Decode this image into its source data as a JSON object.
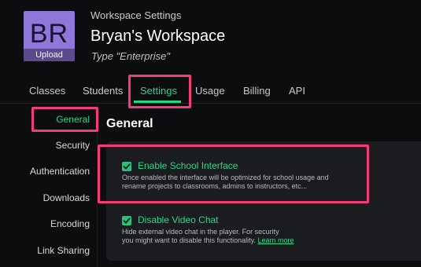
{
  "workspace": {
    "avatar_initials": "BR",
    "avatar_upload_label": "Upload",
    "kicker": "Workspace Settings",
    "name": "Bryan's Workspace",
    "type_text": "Type \"Enterprise\""
  },
  "tabs": [
    {
      "label": "Classes"
    },
    {
      "label": "Students"
    },
    {
      "label": "Settings",
      "active": true
    },
    {
      "label": "Usage"
    },
    {
      "label": "Billing"
    },
    {
      "label": "API"
    }
  ],
  "sidebar": {
    "items": [
      {
        "label": "General",
        "active": true
      },
      {
        "label": "Security"
      },
      {
        "label": "Authentication"
      },
      {
        "label": "Downloads"
      },
      {
        "label": "Encoding"
      },
      {
        "label": "Link Sharing"
      }
    ]
  },
  "main": {
    "section_title": "General",
    "options": [
      {
        "label": "Enable School Interface",
        "checked": true,
        "description_line1": "Once enabled the interface will be optimized for school usage and",
        "description_line2": "rename projects to classrooms, admins to instructors, etc..."
      },
      {
        "label": "Disable Video Chat",
        "checked": true,
        "description_line1": "Hide external video chat in the player. For security",
        "description_line2": "you might want to disable this functionality.",
        "link_label": "Learn more"
      }
    ]
  },
  "colors": {
    "accent": "#24d488",
    "highlight": "#f23d7a",
    "avatar": "#8f77d9",
    "background": "#0c0d0f",
    "panel": "#1b1c20"
  }
}
